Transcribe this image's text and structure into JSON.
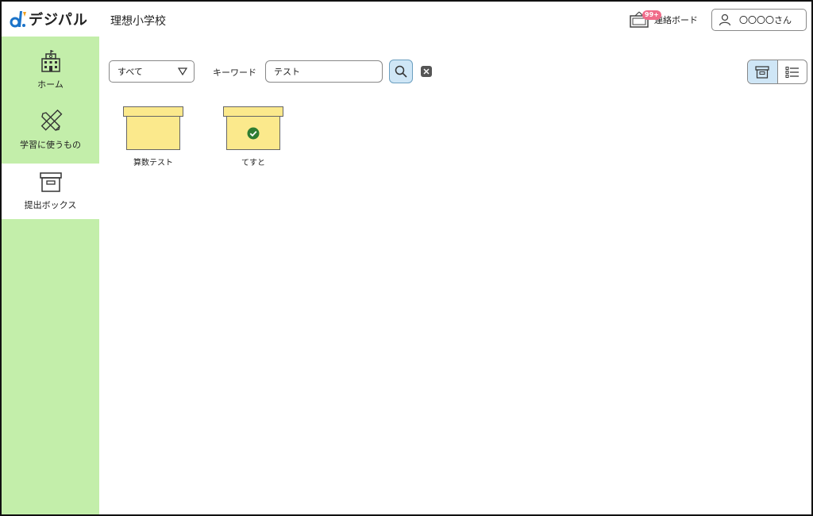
{
  "header": {
    "logo_text": "デジパル",
    "school_name": "理想小学校",
    "board": {
      "badge": "99+",
      "label": "連絡ボード"
    },
    "user": {
      "name": "〇〇〇〇さん"
    }
  },
  "sidebar": {
    "items": [
      {
        "label": "ホーム",
        "icon": "school-building-icon",
        "active": false
      },
      {
        "label": "学習に使うもの",
        "icon": "pencil-ruler-icon",
        "active": false
      },
      {
        "label": "提出ボックス",
        "icon": "archive-box-icon",
        "active": true
      }
    ]
  },
  "toolbar": {
    "filter": {
      "value": "すべて"
    },
    "keyword_label": "キーワード",
    "keyword_value": "テスト",
    "view_mode": "grid"
  },
  "boxes": [
    {
      "label": "算数テスト",
      "submitted": false
    },
    {
      "label": "てすと",
      "submitted": true
    }
  ],
  "colors": {
    "sidebar_bg": "#c3eeaa",
    "box_fill": "#fbe98c",
    "accent_blue": "#cfe6f6",
    "badge_pink": "#f06c8a",
    "check_green": "#2e7d32"
  }
}
